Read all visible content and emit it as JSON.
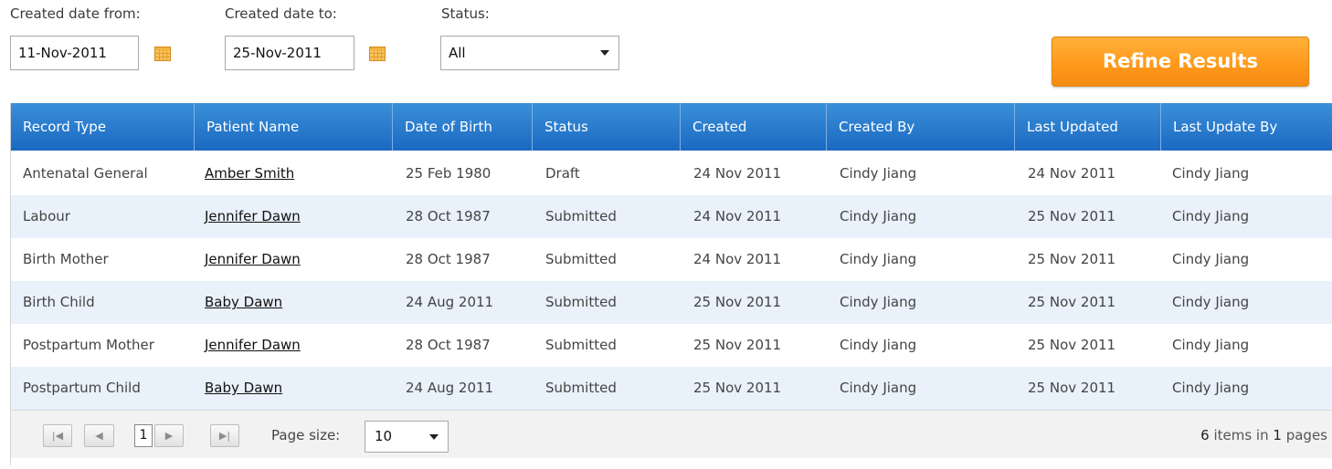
{
  "filters": {
    "date_from_label": "Created date from:",
    "date_from_value": "11-Nov-2011",
    "date_to_label": "Created date to:",
    "date_to_value": "25-Nov-2011",
    "status_label": "Status:",
    "status_value": "All",
    "calendar_icon": "calendar-icon",
    "refine_label": "Refine Results"
  },
  "grid": {
    "columns": [
      "Record Type",
      "Patient Name",
      "Date of Birth",
      "Status",
      "Created",
      "Created By",
      "Last Updated",
      "Last Update By"
    ],
    "rows": [
      [
        "Antenatal General",
        "Amber Smith",
        "25 Feb 1980",
        "Draft",
        "24 Nov 2011",
        "Cindy Jiang",
        "24 Nov 2011",
        "Cindy Jiang"
      ],
      [
        "Labour",
        "Jennifer Dawn",
        "28 Oct 1987",
        "Submitted",
        "24 Nov 2011",
        "Cindy Jiang",
        "25 Nov 2011",
        "Cindy Jiang"
      ],
      [
        "Birth Mother",
        "Jennifer Dawn",
        "28 Oct 1987",
        "Submitted",
        "24 Nov 2011",
        "Cindy Jiang",
        "25 Nov 2011",
        "Cindy Jiang"
      ],
      [
        "Birth Child",
        "Baby Dawn",
        "24 Aug 2011",
        "Submitted",
        "25 Nov 2011",
        "Cindy Jiang",
        "25 Nov 2011",
        "Cindy Jiang"
      ],
      [
        "Postpartum Mother",
        "Jennifer Dawn",
        "28 Oct 1987",
        "Submitted",
        "25 Nov 2011",
        "Cindy Jiang",
        "25 Nov 2011",
        "Cindy Jiang"
      ],
      [
        "Postpartum Child",
        "Baby Dawn",
        "24 Aug 2011",
        "Submitted",
        "25 Nov 2011",
        "Cindy Jiang",
        "25 Nov 2011",
        "Cindy Jiang"
      ]
    ]
  },
  "pager": {
    "current_page": "1",
    "page_size_label": "Page size:",
    "page_size_value": "10",
    "item_count": "6",
    "items_in_text": "items in",
    "page_count": "1",
    "pages_text": "pages",
    "icons": [
      "first-page-icon",
      "prev-page-icon",
      "next-page-icon",
      "last-page-icon"
    ]
  },
  "colors": {
    "header_blue": "#1b69c2",
    "row_alt": "#e9f1fb",
    "refine_orange": "#ff9a1c"
  }
}
